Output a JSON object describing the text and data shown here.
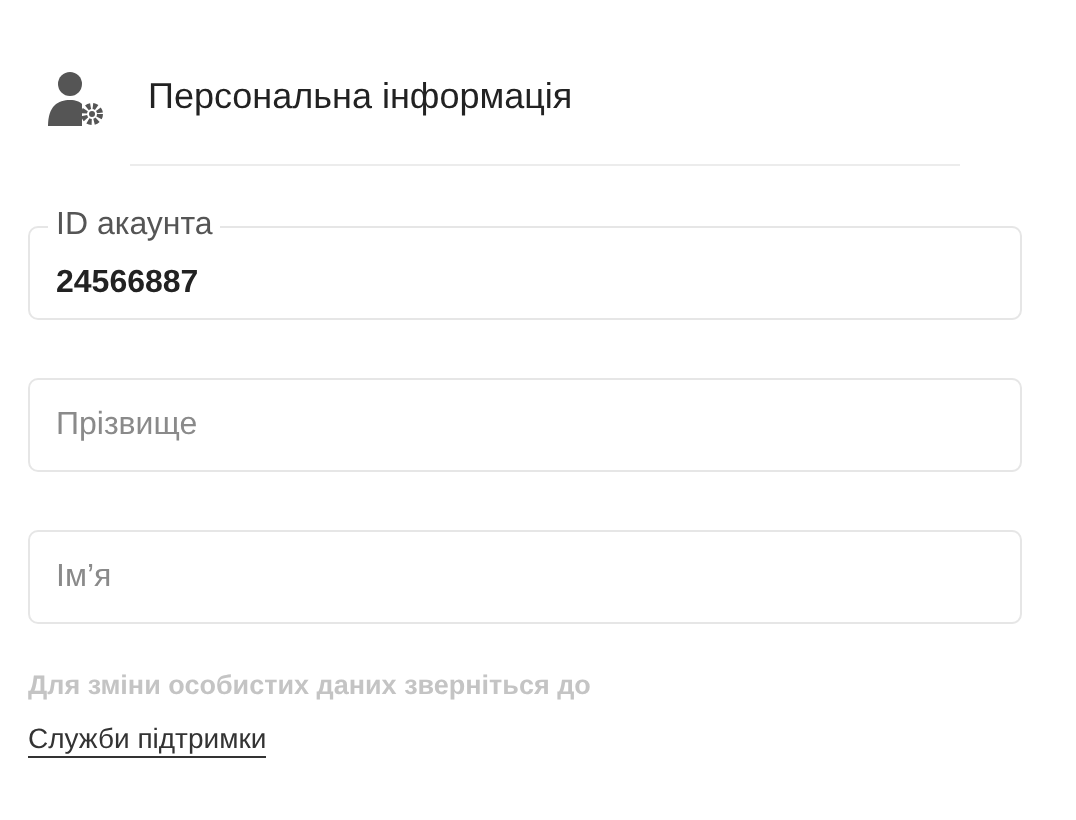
{
  "header": {
    "title": "Персональна інформація"
  },
  "fields": [
    {
      "kind": "labeled",
      "label": "ID акаунта",
      "value": "24566887"
    },
    {
      "kind": "empty",
      "placeholder": "Прізвище"
    },
    {
      "kind": "empty",
      "placeholder": "Ім’я"
    }
  ],
  "note": {
    "text": "Для зміни особистих даних зверніться до",
    "link": "Служби підтримки"
  }
}
